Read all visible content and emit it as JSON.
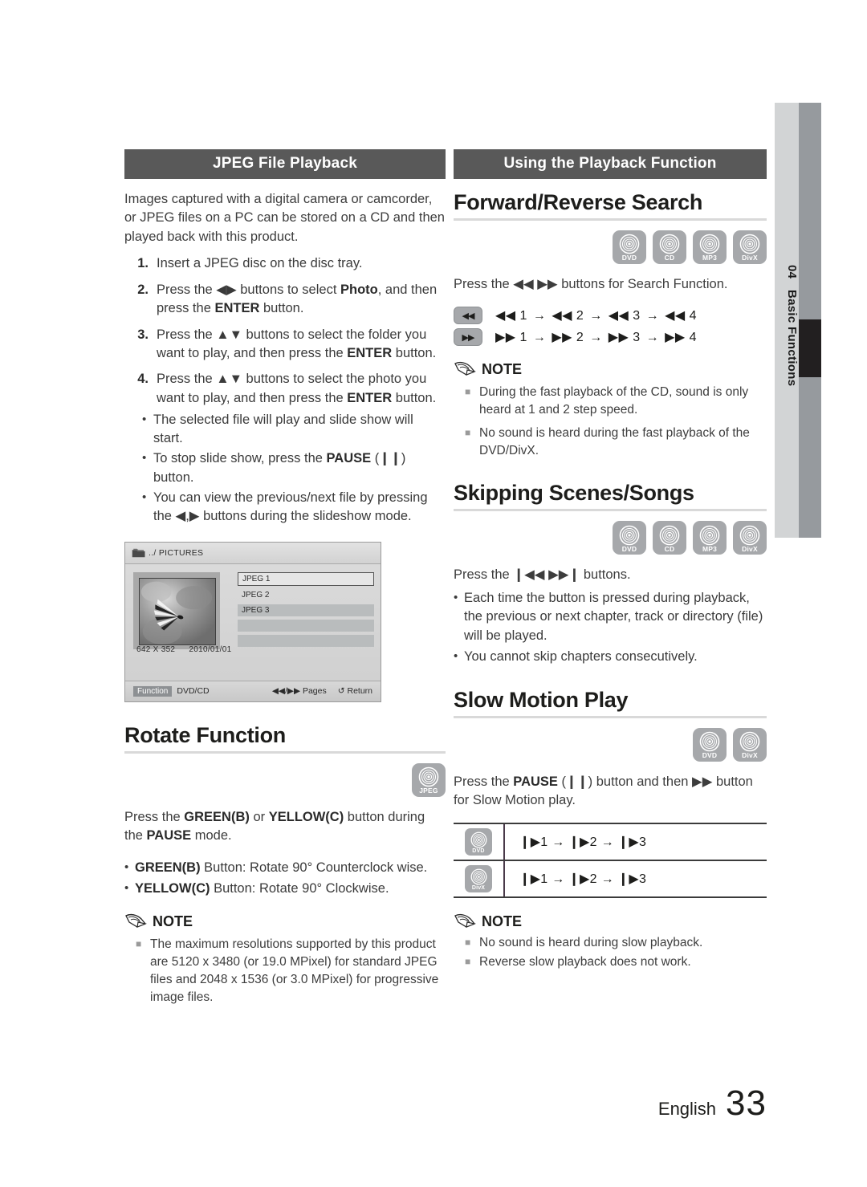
{
  "chapter_tab": {
    "number": "04",
    "label": "Basic Functions"
  },
  "left_column": {
    "banner": "JPEG File Playback",
    "intro": "Images captured with a digital camera or camcorder, or JPEG files on a PC can be stored on a CD and then played back with this product.",
    "steps": [
      {
        "num": "1.",
        "text": "Insert a JPEG disc on the disc tray."
      },
      {
        "num": "2.",
        "text": "Press the ◀▶ buttons to select Photo, and then press the ENTER button."
      },
      {
        "num": "3.",
        "text": "Press the ▲▼ buttons to select the folder you want to play, and then press the ENTER button."
      },
      {
        "num": "4.",
        "text": "Press the ▲▼ buttons to select the photo you want to play, and then press the ENTER button."
      }
    ],
    "step4_bullets": [
      "The selected file will play and slide show will start.",
      "To stop slide show, press the PAUSE (❙❙) button.",
      "You can view the previous/next file by pressing the ◀,▶ buttons during the slideshow mode."
    ],
    "osd": {
      "path": "../ PICTURES",
      "files": [
        "JPEG 1",
        "JPEG 2",
        "JPEG 3",
        "",
        ""
      ],
      "dimensions": "642 X 352",
      "date": "2010/01/01",
      "footer_function": "Function",
      "footer_source": "DVD/CD",
      "footer_pages": "Pages",
      "footer_pages_icon": "◀◀/▶▶",
      "footer_return": "Return",
      "footer_return_icon": "↺"
    },
    "rotate": {
      "title": "Rotate Function",
      "badges": [
        "JPEG"
      ],
      "intro": "Press the GREEN(B) or YELLOW(C) button during the PAUSE mode.",
      "bullets": [
        "GREEN(B) Button: Rotate 90° Counterclock wise.",
        "YELLOW(C) Button: Rotate 90° Clockwise."
      ],
      "note_title": "NOTE",
      "notes": [
        "The maximum resolutions supported by this product are 5120 x 3480 (or 19.0 MPixel) for standard JPEG files and 2048 x 1536 (or 3.0 MPixel) for progressive image files."
      ]
    }
  },
  "right_column": {
    "banner": "Using the Playback Function",
    "search": {
      "title": "Forward/Reverse Search",
      "badges": [
        "DVD",
        "CD",
        "MP3",
        "DivX"
      ],
      "intro": "Press the ◀◀ ▶▶ buttons for Search Function.",
      "speed_rows": [
        {
          "key": "◀◀",
          "steps": [
            "◀◀ 1",
            "◀◀ 2",
            "◀◀ 3",
            "◀◀ 4"
          ]
        },
        {
          "key": "▶▶",
          "steps": [
            "▶▶ 1",
            "▶▶ 2",
            "▶▶ 3",
            "▶▶ 4"
          ]
        }
      ],
      "note_title": "NOTE",
      "notes": [
        "During the fast playback of the CD, sound is only heard at 1 and 2 step speed.",
        "No sound is heard during the fast playback of the DVD/DivX."
      ]
    },
    "skipping": {
      "title": "Skipping Scenes/Songs",
      "badges": [
        "DVD",
        "CD",
        "MP3",
        "DivX"
      ],
      "intro": "Press the ❙◀◀ ▶▶❙ buttons.",
      "bullets": [
        "Each time the button is pressed during playback, the previous or next chapter, track or directory (file) will be played.",
        "You cannot skip chapters consecutively."
      ]
    },
    "slow": {
      "title": "Slow Motion Play",
      "badges": [
        "DVD",
        "DivX"
      ],
      "intro": "Press the PAUSE (❙❙) button and then ▶▶ button for Slow Motion play.",
      "table_rows": [
        {
          "disc": "DVD",
          "steps": [
            "❙▶1",
            "❙▶2",
            "❙▶3"
          ]
        },
        {
          "disc": "DivX",
          "steps": [
            "❙▶1",
            "❙▶2",
            "❙▶3"
          ]
        }
      ],
      "note_title": "NOTE",
      "notes": [
        "No sound is heard during slow playback.",
        "Reverse slow playback does not work."
      ]
    }
  },
  "footer": {
    "language": "English",
    "page_number": "33"
  },
  "colors": {
    "banner_bg": "#595959",
    "badge_bg": "#a6a8ab",
    "tab_light": "#d2d4d5",
    "tab_dark": "#969a9e",
    "marker": "#221f20"
  }
}
